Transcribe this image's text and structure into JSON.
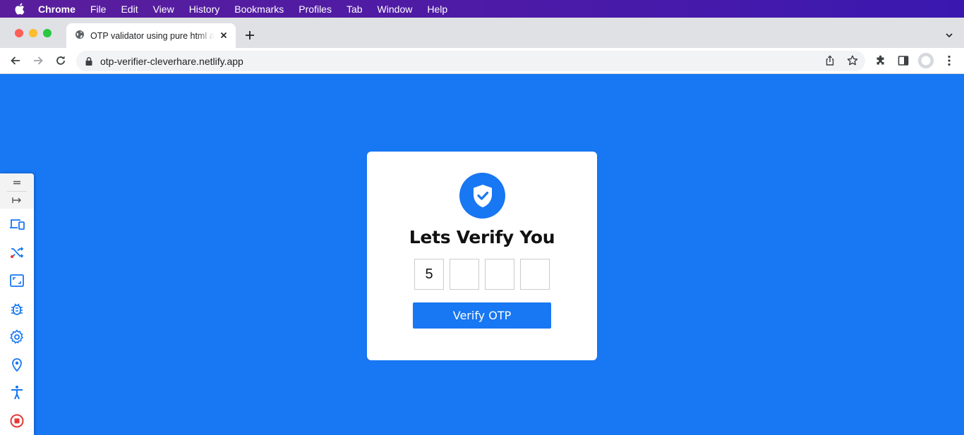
{
  "menubar": {
    "app": "Chrome",
    "items": [
      "File",
      "Edit",
      "View",
      "History",
      "Bookmarks",
      "Profiles",
      "Tab",
      "Window",
      "Help"
    ]
  },
  "tab": {
    "title": "OTP validator using pure html and javascript",
    "favicon": "globe-icon"
  },
  "toolbar": {
    "url": "otp-verifier-cleverhare.netlify.app"
  },
  "page": {
    "heading": "Lets Verify You",
    "otp_values": [
      "5",
      "",
      "",
      ""
    ],
    "button_label": "Verify OTP",
    "icon": "shield-check-icon",
    "colors": {
      "background": "#1877f2",
      "card": "#ffffff",
      "button": "#1877f2"
    }
  },
  "side_panel": {
    "icons": [
      "drag-handle-icon",
      "collapse-icon",
      "devices-icon",
      "shuffle-icon",
      "screenshot-icon",
      "bug-icon",
      "settings-icon",
      "location-icon",
      "accessibility-icon",
      "record-stop-icon"
    ]
  }
}
